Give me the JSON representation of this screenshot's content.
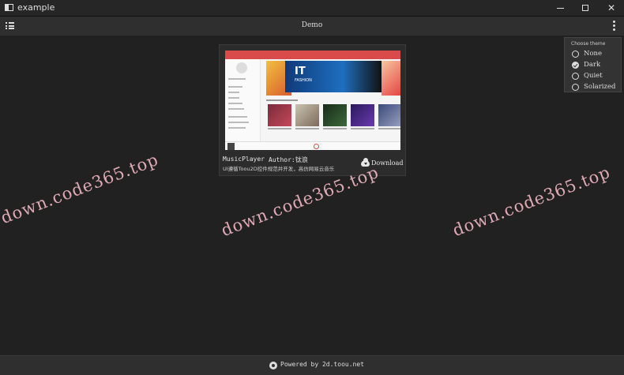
{
  "window": {
    "title": "example",
    "minimize_label": "",
    "maximize_label": "",
    "close_label": "✕"
  },
  "toolbar": {
    "caption": "Demo"
  },
  "theme_menu": {
    "header": "Choose theme",
    "options": [
      {
        "label": "None",
        "selected": false
      },
      {
        "label": "Dark",
        "selected": true
      },
      {
        "label": "Quiet",
        "selected": false
      },
      {
        "label": "Solarized",
        "selected": false
      }
    ]
  },
  "card": {
    "name": "MusicPlayer",
    "author": "Author:钛浪",
    "description": "UI遵循Toou2D控件规范并开发，高仿网易云音乐",
    "download_label": "Download",
    "thumbnail": {
      "banner_text": "IT",
      "banner_sub": "FASHION"
    }
  },
  "watermarks": [
    "down.code365.top",
    "down.code365.top",
    "down.code365.top"
  ],
  "footer": {
    "text": "Powered by 2d.toou.net"
  },
  "colors": {
    "background": "#212121",
    "bar": "#2f2f2f",
    "accent": "#d94b4b",
    "watermark": "#f4b8c4"
  }
}
